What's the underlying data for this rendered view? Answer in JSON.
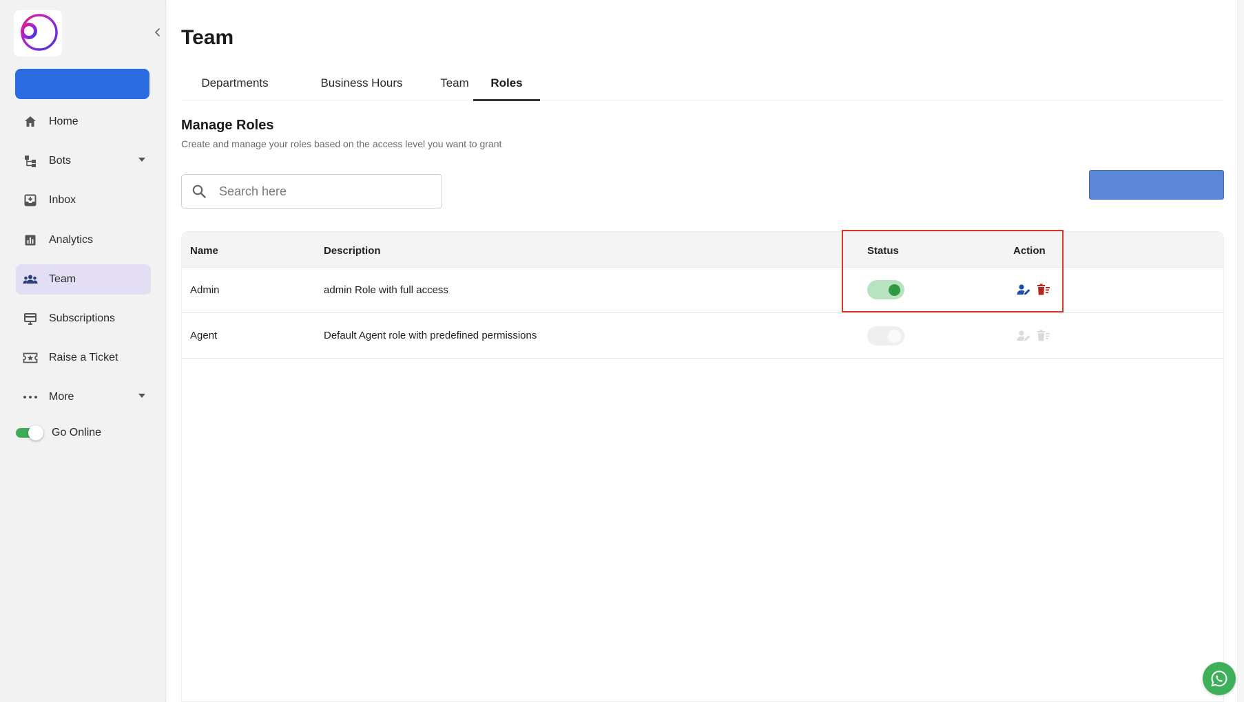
{
  "sidebar": {
    "items": [
      {
        "label": "Home",
        "icon": "home-icon"
      },
      {
        "label": "Bots",
        "icon": "bots-icon",
        "has_dropdown": true
      },
      {
        "label": "Inbox",
        "icon": "inbox-icon"
      },
      {
        "label": "Analytics",
        "icon": "analytics-icon"
      },
      {
        "label": "Team",
        "icon": "team-icon",
        "active": true
      },
      {
        "label": "Subscriptions",
        "icon": "subscriptions-icon"
      },
      {
        "label": "Raise a Ticket",
        "icon": "ticket-icon"
      },
      {
        "label": "More",
        "icon": "more-icon",
        "has_dropdown": true
      }
    ],
    "online_label": "Go Online",
    "online_on": true
  },
  "header": {
    "title": "Team"
  },
  "tabs": [
    {
      "label": "Departments"
    },
    {
      "label": "Business Hours"
    },
    {
      "label": "Team"
    },
    {
      "label": "Roles",
      "active": true
    }
  ],
  "section": {
    "title": "Manage Roles",
    "subtitle": "Create and manage your roles based on the access level you want to grant"
  },
  "search": {
    "placeholder": "Search here"
  },
  "table": {
    "columns": [
      "Name",
      "Description",
      "Status",
      "Action"
    ],
    "rows": [
      {
        "name": "Admin",
        "description": "admin Role with full access",
        "status_on": true,
        "actions_enabled": true
      },
      {
        "name": "Agent",
        "description": "Default Agent role with predefined permissions",
        "status_on": false,
        "actions_enabled": false
      }
    ]
  },
  "colors": {
    "accent": "#2b6be0",
    "active_nav": "#e3def3",
    "toggle_on": "#2e9a42",
    "highlight": "#d9352b",
    "edit_icon": "#1f4ea8",
    "delete_icon": "#b3261e",
    "whatsapp": "#3eb059"
  }
}
